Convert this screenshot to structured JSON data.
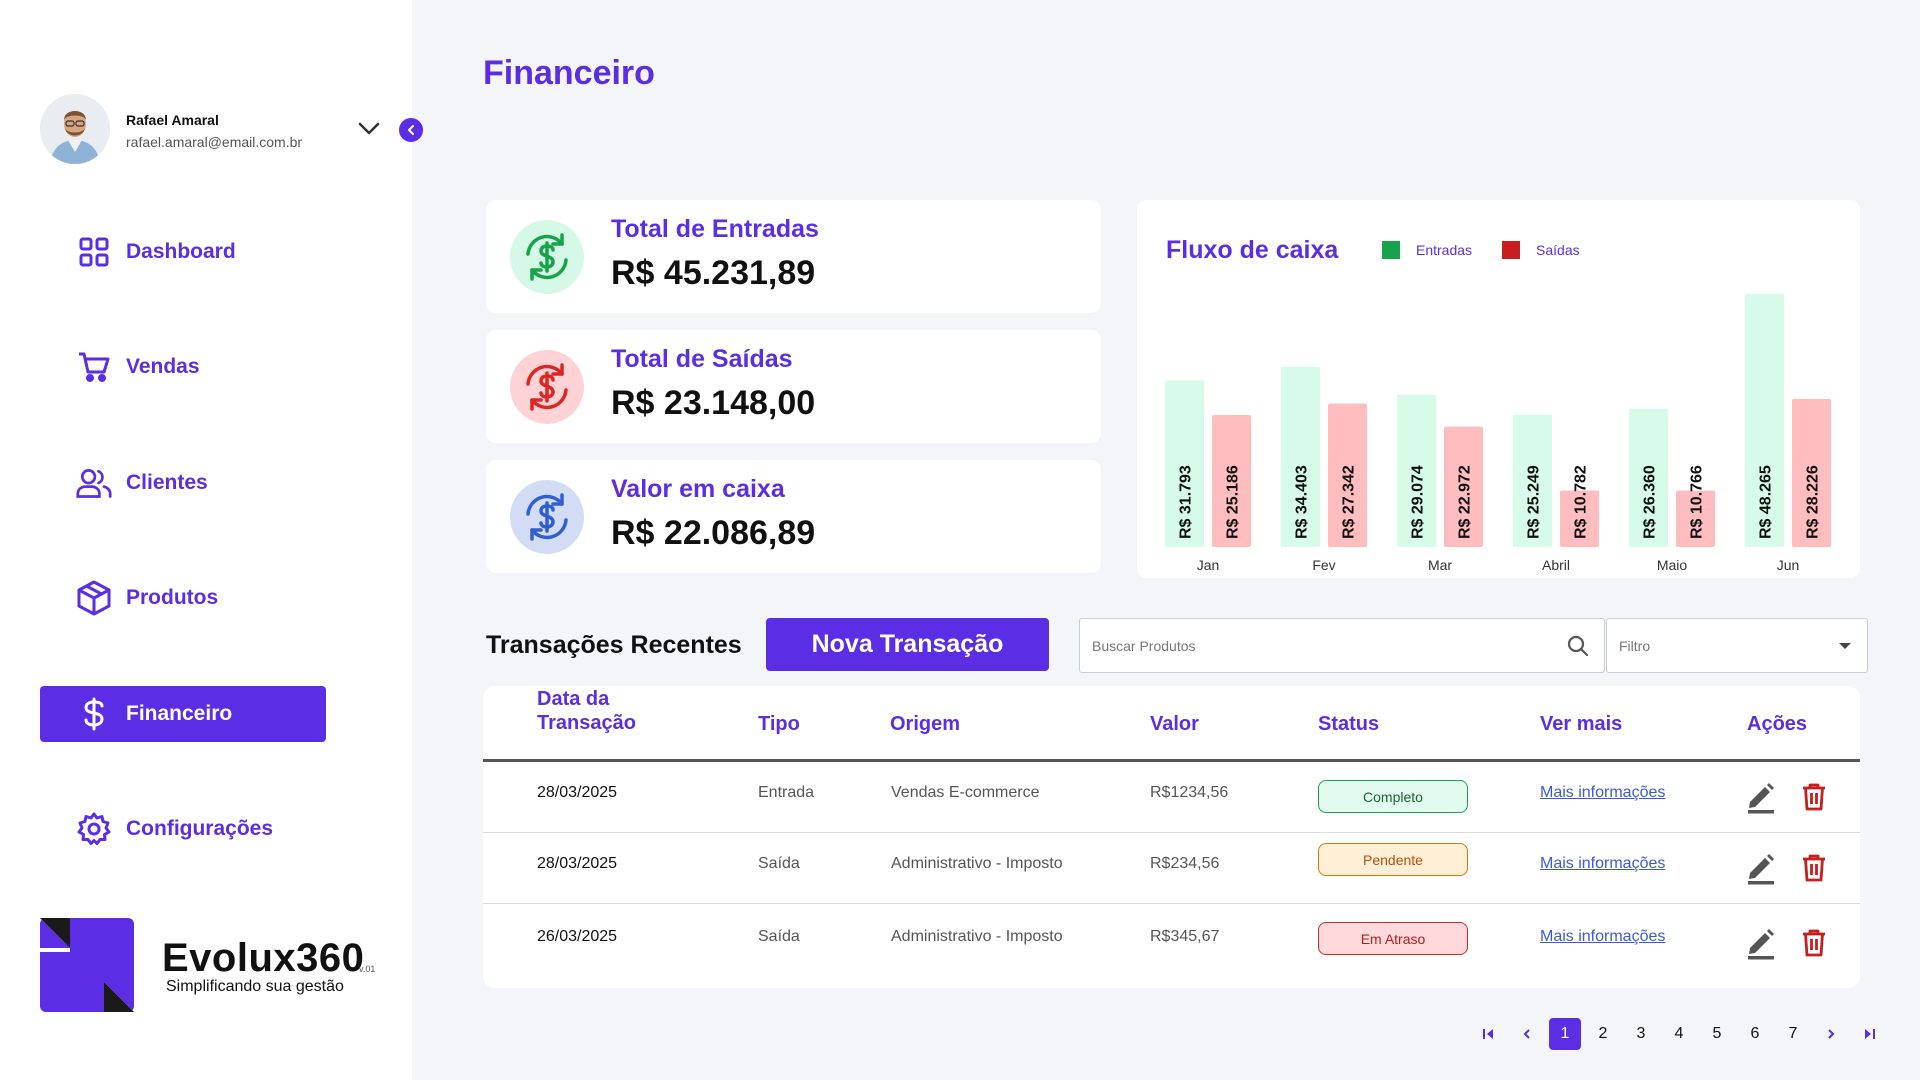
{
  "user": {
    "name": "Rafael Amaral",
    "email": "rafael.amaral@email.com.br"
  },
  "nav": [
    {
      "label": "Dashboard",
      "icon": "grid-icon",
      "active": false
    },
    {
      "label": "Vendas",
      "icon": "cart-icon",
      "active": false
    },
    {
      "label": "Clientes",
      "icon": "users-icon",
      "active": false
    },
    {
      "label": "Produtos",
      "icon": "box-icon",
      "active": false
    },
    {
      "label": "Financeiro",
      "icon": "dollar-icon",
      "active": true
    },
    {
      "label": "Configurações",
      "icon": "gear-icon",
      "active": false
    }
  ],
  "brand": {
    "name": "Evolux360",
    "version": "v.01",
    "tagline": "Simplificando sua gestão"
  },
  "page_title": "Financeiro",
  "cards": [
    {
      "label": "Total de Entradas",
      "value": "R$ 45.231,89",
      "color": "#16a34a",
      "bg": "#d6f8e6"
    },
    {
      "label": "Total de Saídas",
      "value": "R$ 23.148,00",
      "color": "#dc2626",
      "bg": "#ffd3d6"
    },
    {
      "label": "Valor em caixa",
      "value": "R$ 22.086,89",
      "color": "#2f5fd0",
      "bg": "#d2dcf5"
    }
  ],
  "chart_data": {
    "type": "bar",
    "title": "Fluxo de caixa",
    "categories": [
      "Jan",
      "Fev",
      "Mar",
      "Abril",
      "Maio",
      "Jun"
    ],
    "series": [
      {
        "name": "Entradas",
        "values": [
          31793,
          34403,
          29074,
          25249,
          26360,
          48265
        ],
        "labels": [
          "R$ 31.793",
          "R$ 34.403",
          "R$ 29.074",
          "R$ 25.249",
          "R$ 26.360",
          "R$ 48.265"
        ],
        "color": "#16a34a",
        "bar_color": "#d6fbe8"
      },
      {
        "name": "Saídas",
        "values": [
          25186,
          27342,
          22972,
          10782,
          10766,
          28226
        ],
        "labels": [
          "R$ 25.186",
          "R$ 27.342",
          "R$ 22.972",
          "R$ 10.782",
          "R$ 10.766",
          "R$ 28.226"
        ],
        "color": "#c81e1e",
        "bar_color": "#ffbdbf"
      }
    ],
    "ylim": [
      0,
      48265
    ],
    "grid": false,
    "legend": "top"
  },
  "transactions": {
    "title": "Transações Recentes",
    "new_button": "Nova Transação",
    "search_placeholder": "Buscar Produtos",
    "filter_label": "Filtro",
    "headers": [
      "Data da Transação",
      "Tipo",
      "Origem",
      "Valor",
      "Status",
      "Ver mais",
      "Ações"
    ],
    "rows": [
      {
        "date": "28/03/2025",
        "type": "Entrada",
        "origin": "Vendas E-commerce",
        "value": "R$1234,56",
        "status": "Completo",
        "status_kind": "completo",
        "link": "Mais informações"
      },
      {
        "date": "28/03/2025",
        "type": "Saída",
        "origin": "Administrativo - Imposto",
        "value": "R$234,56",
        "status": "Pendente",
        "status_kind": "pendente",
        "link": "Mais informações"
      },
      {
        "date": "26/03/2025",
        "type": "Saída",
        "origin": "Administrativo - Imposto",
        "value": "R$345,67",
        "status": "Em Atraso",
        "status_kind": "atraso",
        "link": "Mais informações"
      }
    ]
  },
  "pagination": {
    "pages": [
      "1",
      "2",
      "3",
      "4",
      "5",
      "6",
      "7"
    ],
    "current": "1"
  },
  "colors": {
    "accent": "#5b2ee6",
    "danger": "#c81e1e"
  }
}
